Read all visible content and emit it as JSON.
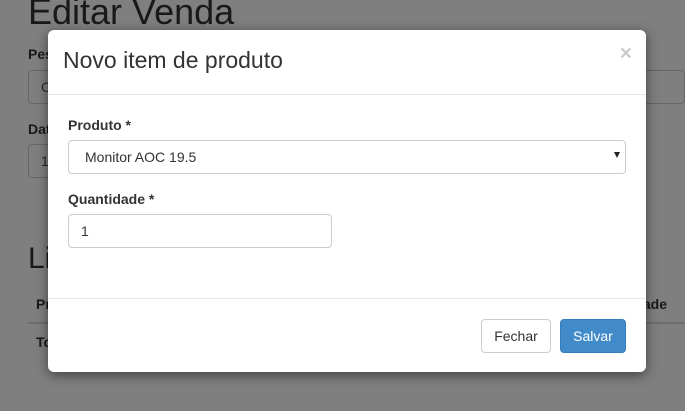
{
  "page": {
    "title": "Editar Venda",
    "fields": [
      {
        "label": "Pes",
        "value": "C"
      },
      {
        "label": "Dat",
        "value": "1"
      }
    ],
    "section_title": "Li",
    "table": {
      "headers": [
        "Pr",
        "ade"
      ],
      "rows": [
        [
          "To"
        ]
      ]
    }
  },
  "modal": {
    "title": "Novo item de produto",
    "close_label": "×",
    "product": {
      "label": "Produto *",
      "selected": "Monitor AOC 19.5"
    },
    "quantity": {
      "label": "Quantidade *",
      "value": "1"
    },
    "buttons": {
      "close": "Fechar",
      "save": "Salvar"
    }
  },
  "colors": {
    "primary": "#428bca",
    "backdrop": "rgba(0,0,0,0.5)"
  },
  "icons": {
    "close": "close-icon",
    "select_arrow": "chevron-down-icon"
  }
}
